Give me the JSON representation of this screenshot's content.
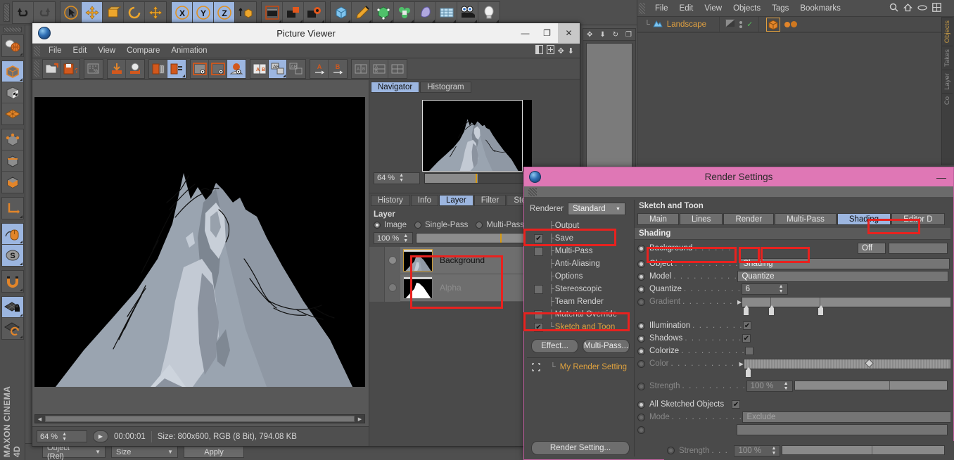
{
  "app": {
    "brand": "MAXON CINEMA 4D"
  },
  "objects_manager": {
    "menus": [
      "File",
      "Edit",
      "View",
      "Objects",
      "Tags",
      "Bookmarks"
    ],
    "icons": [
      "search-icon",
      "home-icon",
      "eye-icon",
      "layout-icon"
    ],
    "object_row": {
      "name": "Landscape",
      "tree_glyph": "└"
    },
    "vertical_tabs": [
      "Objects",
      "Takes",
      "Layer",
      "Co"
    ]
  },
  "picture_viewer": {
    "title": "Picture Viewer",
    "window_buttons": {
      "minimize": "—",
      "maximize": "❐",
      "close": "✕"
    },
    "menus": [
      "File",
      "Edit",
      "View",
      "Compare",
      "Animation"
    ],
    "navigator": {
      "tabs": [
        {
          "label": "Navigator",
          "active": true
        },
        {
          "label": "Histogram",
          "active": false
        }
      ],
      "zoom": "64 %"
    },
    "lower_tabs": [
      {
        "label": "History",
        "active": false
      },
      {
        "label": "Info",
        "active": false
      },
      {
        "label": "Layer",
        "active": true
      },
      {
        "label": "Filter",
        "active": false
      },
      {
        "label": "Stere",
        "active": false
      }
    ],
    "layer_panel": {
      "title": "Layer",
      "modes": [
        {
          "label": "Image",
          "selected": true
        },
        {
          "label": "Single-Pass",
          "selected": false
        },
        {
          "label": "Multi-Pass",
          "selected": false
        }
      ],
      "opacity": "100 %",
      "layers": [
        {
          "name": "Background",
          "active": true
        },
        {
          "name": "Alpha",
          "active": false
        }
      ]
    },
    "status": {
      "zoom": "64 %",
      "play_icon": "play-icon",
      "time": "00:00:01",
      "info": "Size: 800x600, RGB (8 Bit), 794.08 KB"
    }
  },
  "render_settings": {
    "title": "Render Settings",
    "minimize": "—",
    "renderer": {
      "label": "Renderer",
      "value": "Standard"
    },
    "tree": [
      {
        "label": "Output",
        "check": "none",
        "branch": "├",
        "orange": false
      },
      {
        "label": "Save",
        "check": "checked",
        "branch": "├",
        "orange": false
      },
      {
        "label": "Multi-Pass",
        "check": "empty",
        "branch": "├",
        "orange": false
      },
      {
        "label": "Anti-Aliasing",
        "check": "none",
        "branch": "├",
        "orange": false
      },
      {
        "label": "Options",
        "check": "none",
        "branch": "├",
        "orange": false
      },
      {
        "label": "Stereoscopic",
        "check": "empty",
        "branch": "├",
        "orange": false
      },
      {
        "label": "Team Render",
        "check": "none",
        "branch": "├",
        "orange": false
      },
      {
        "label": "Material Override",
        "check": "empty",
        "branch": "├",
        "orange": false
      },
      {
        "label": "Sketch and Toon",
        "check": "checked",
        "branch": "└",
        "orange": true
      }
    ],
    "buttons": {
      "effect": "Effect...",
      "multipass": "Multi-Pass..."
    },
    "my_render_setting": "My Render Setting",
    "render_setting_button": "Render Setting...",
    "panel_title": "Sketch and Toon",
    "tabs": [
      {
        "label": "Main",
        "active": false
      },
      {
        "label": "Lines",
        "active": false
      },
      {
        "label": "Render",
        "active": false
      },
      {
        "label": "Multi-Pass",
        "active": false
      },
      {
        "label": "Shading",
        "active": true
      },
      {
        "label": "Editor D",
        "active": false
      }
    ],
    "section_title": "Shading",
    "properties": [
      {
        "name": "Background",
        "dots": ". . . . . . .",
        "type": "combo-with-empty",
        "value": "Off",
        "dim": false
      },
      {
        "name": "Object",
        "dots": ". . . . . . . . . .",
        "type": "combo",
        "value": "Shading",
        "dim": false
      },
      {
        "name": "Model",
        "dots": ". . . . . . . . . .",
        "type": "combo",
        "value": "Quantize",
        "dim": false
      },
      {
        "name": "Quantize",
        "dots": ". . . . . . . . .",
        "type": "spinner",
        "value": "6",
        "dim": false
      },
      {
        "name": "Gradient",
        "dots": ". . . . . . . .",
        "type": "gradient",
        "value": "",
        "dim": true
      },
      {
        "name": "Illumination",
        "dots": ". . . . . . . .",
        "type": "checkbox",
        "value": "on",
        "dim": false
      },
      {
        "name": "Shadows",
        "dots": ". . . . . . . . .",
        "type": "checkbox",
        "value": "on",
        "dim": false
      },
      {
        "name": "Colorize",
        "dots": ". . . . . . . . . .",
        "type": "checkbox",
        "value": "off",
        "dim": false
      },
      {
        "name": "Color",
        "dots": ". . . . . . . . . .",
        "type": "colorband",
        "value": "",
        "dim": true
      },
      {
        "name": "Strength",
        "dots": ". . . . . . . . . .",
        "type": "slider",
        "value": "100 %",
        "dim": true
      },
      {
        "name": "All Sketched Objects",
        "dots": "",
        "type": "checkbox",
        "value": "on",
        "dim": false
      },
      {
        "name": "Mode",
        "dots": ". . . . . . . . . . .",
        "type": "combo",
        "value": "Exclude",
        "dim": true
      }
    ],
    "footer_property": {
      "name": "Strength",
      "dots": ". . .",
      "value": "100 %"
    }
  },
  "bottom_bar": {
    "fields": [
      "Object (Rel)",
      "Size"
    ],
    "apply": "Apply",
    "right_label": "Strength. . ."
  }
}
